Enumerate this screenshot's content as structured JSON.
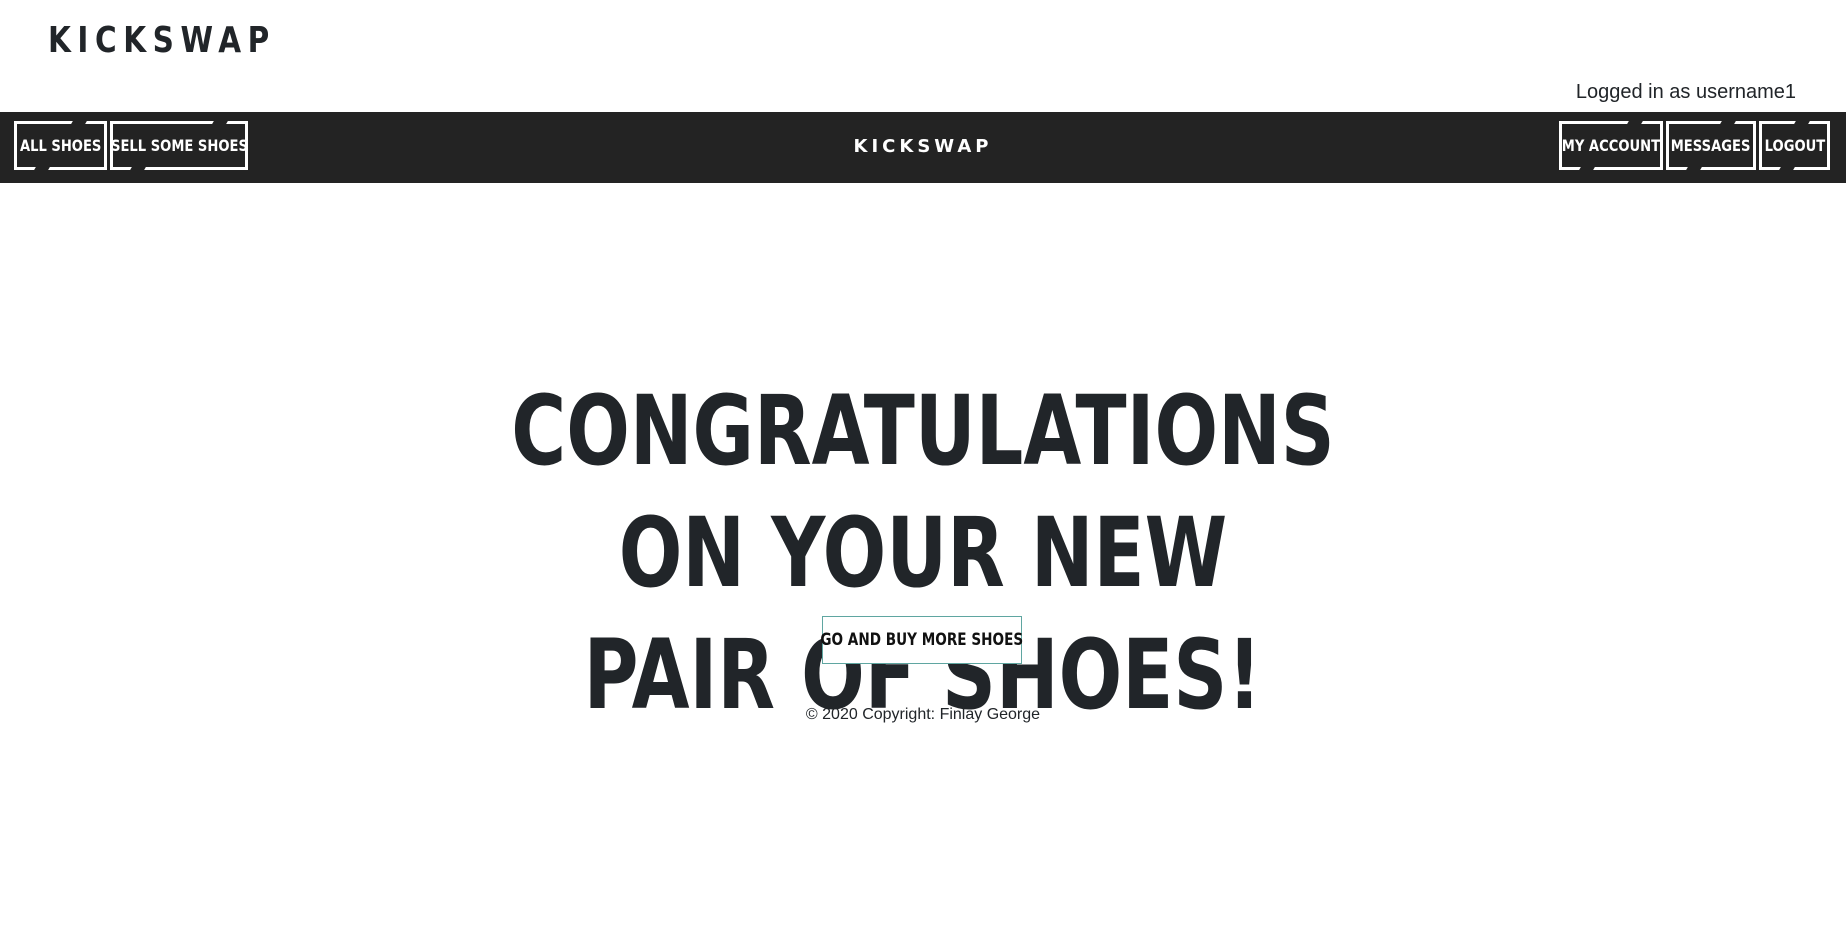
{
  "header": {
    "brand": "KICKSWAP",
    "login_status": "Logged in as username1"
  },
  "navbar": {
    "left_items": [
      {
        "label": "ALL SHOES"
      },
      {
        "label": "SELL SOME SHOES"
      }
    ],
    "center_brand": "KICKSWAP",
    "right_items": [
      {
        "label": "MY ACCOUNT"
      },
      {
        "label": "MESSAGES"
      },
      {
        "label": "LOGOUT"
      }
    ]
  },
  "main": {
    "headline_line1": "CONGRATULATIONS ON YOUR NEW",
    "headline_line2": "PAIR OF SHOES!",
    "cta_label": "GO AND BUY MORE SHOES"
  },
  "footer": {
    "copyright": "© 2020 Copyright: Finlay George"
  },
  "colors": {
    "navbar_bg": "#232323",
    "text": "#212529",
    "cta_border": "#5fa6a1",
    "background": "#ffffff"
  }
}
